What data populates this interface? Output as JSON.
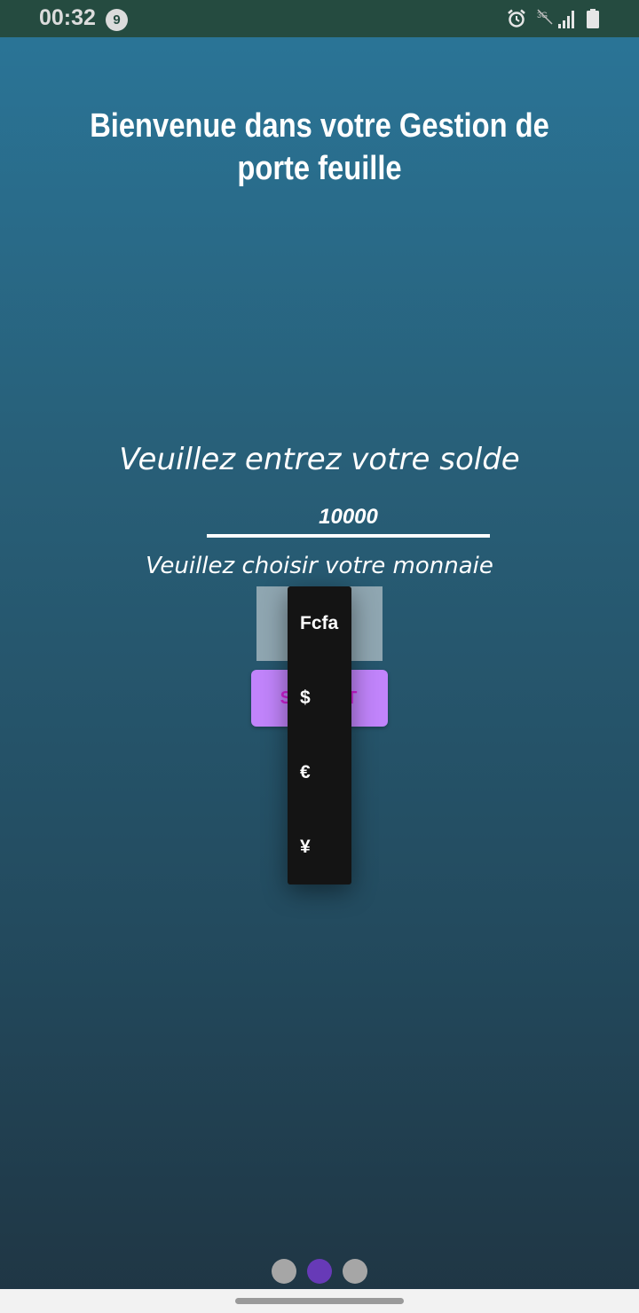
{
  "status_bar": {
    "time": "00:32",
    "notification_count": "9",
    "icons": [
      "alarm-icon",
      "no-data-icon",
      "signal-icon",
      "battery-icon"
    ]
  },
  "header": {
    "title": "Bienvenue dans votre Gestion de porte feuille"
  },
  "form": {
    "balance_prompt": "Veuillez entrez votre solde",
    "balance_value": "10000",
    "currency_prompt": "Veuillez choisir votre monnaie",
    "submit_label": "SUBMIT"
  },
  "currency_dropdown": {
    "options": [
      "Fcfa",
      "$",
      "€",
      "¥"
    ]
  },
  "pager": {
    "pages": 3,
    "active_index": 1
  },
  "colors": {
    "status_bar": "#254b40",
    "submit_background": "#c184fb",
    "submit_text": "#d21fd9",
    "active_dot": "#673ab7",
    "inactive_dot": "#a6a6a6"
  }
}
